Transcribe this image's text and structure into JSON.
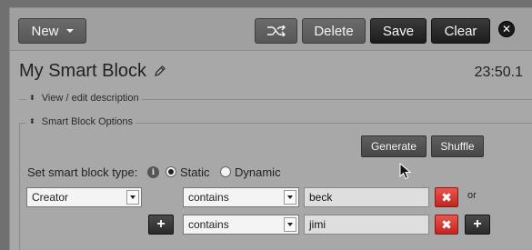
{
  "toolbar": {
    "new_label": "New",
    "delete_label": "Delete",
    "save_label": "Save",
    "clear_label": "Clear"
  },
  "header": {
    "title": "My Smart Block",
    "length": "23:50.1"
  },
  "description_section": {
    "legend": "View / edit description"
  },
  "options_section": {
    "legend": "Smart Block Options",
    "generate_label": "Generate",
    "shuffle_label": "Shuffle",
    "type_label": "Set smart block type:",
    "type_options": [
      "Static",
      "Dynamic"
    ],
    "selected_type": "Static"
  },
  "criteria": [
    {
      "field": "Creator",
      "modifier": "contains",
      "value": "beck",
      "connector": "or"
    },
    {
      "field": "",
      "modifier": "contains",
      "value": "jimi",
      "connector": ""
    }
  ],
  "colors": {
    "accent_dark": "#1c1c1c",
    "remove_red": "#d7372f",
    "panel_bg": "#a8a8a8"
  }
}
